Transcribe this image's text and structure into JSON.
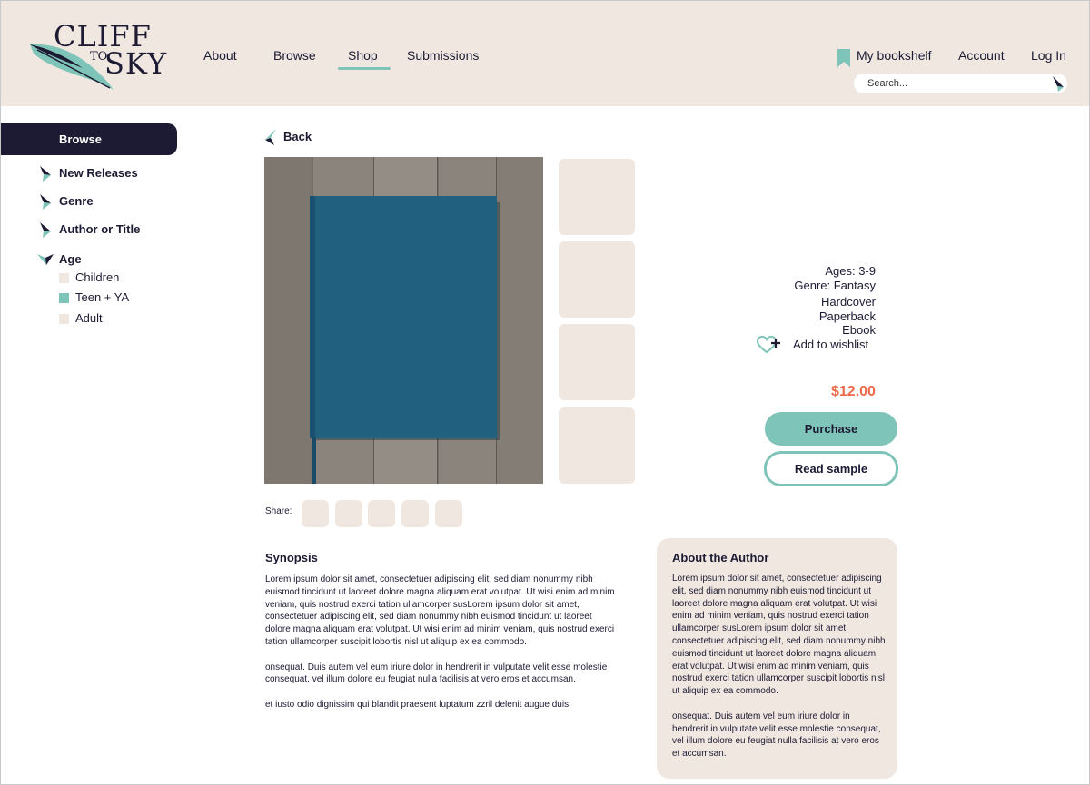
{
  "logo": {
    "line1": "CLIFF",
    "line2": "TO",
    "line3": "SKY"
  },
  "nav": {
    "about": "About",
    "browse": "Browse",
    "shop": "Shop",
    "submissions": "Submissions"
  },
  "header": {
    "bookshelf": "My bookshelf",
    "account": "Account",
    "login": "Log In",
    "search_placeholder": "Search..."
  },
  "sidebar": {
    "heading": "Browse",
    "items": [
      "New Releases",
      "Genre",
      "Author or Title",
      "Age"
    ],
    "age_options": [
      {
        "label": "Children",
        "checked": false
      },
      {
        "label": "Teen + YA",
        "checked": true
      },
      {
        "label": "Adult",
        "checked": false
      }
    ]
  },
  "product": {
    "back": "Back",
    "ages": "Ages: 3-9",
    "genre": "Genre: Fantasy",
    "formats": [
      "Hardcover",
      "Paperback",
      "Ebook"
    ],
    "wishlist": "Add to wishlist",
    "price": "$12.00",
    "purchase": "Purchase",
    "read_sample": "Read sample",
    "share_label": "Share:"
  },
  "synopsis": {
    "title": "Synopsis",
    "paragraphs": [
      "Lorem ipsum dolor sit amet, consectetuer adipiscing elit, sed diam nonummy nibh euismod tincidunt ut laoreet dolore magna aliquam erat volutpat. Ut wisi enim ad minim veniam, quis nostrud exerci tation ullamcorper susLorem ipsum dolor sit amet, consectetuer adipiscing elit, sed diam nonummy nibh euismod tincidunt ut laoreet dolore magna aliquam erat volutpat. Ut wisi enim ad minim veniam, quis nostrud exerci tation ullamcorper suscipit lobortis nisl ut aliquip ex ea commodo.",
      "onsequat. Duis autem vel eum iriure dolor in hendrerit in vulputate velit esse molestie consequat, vel illum dolore eu feugiat nulla facilisis at vero eros et accumsan.",
      "et iusto odio dignissim qui blandit praesent luptatum zzril delenit augue duis"
    ]
  },
  "author": {
    "title": "About the Author",
    "paragraphs": [
      "Lorem ipsum dolor sit amet, consectetuer adipiscing elit, sed diam nonummy nibh euismod tincidunt ut laoreet dolore magna aliquam erat volutpat. Ut wisi enim ad minim veniam, quis nostrud exerci tation ullamcorper susLorem ipsum dolor sit amet, consectetuer adipiscing elit, sed diam nonummy nibh euismod tincidunt ut laoreet dolore magna aliquam erat volutpat. Ut wisi enim ad minim veniam, quis nostrud exerci tation ullamcorper suscipit lobortis nisl ut aliquip ex ea commodo.",
      "onsequat. Duis autem vel eum iriure dolor in hendrerit in vulputate velit esse molestie consequat, vel illum dolore eu feugiat nulla facilisis at vero eros et accumsan."
    ]
  },
  "colors": {
    "navy": "#1c1b33",
    "teal": "#7fc4b8",
    "sand": "#f0e7e1",
    "price": "#f0684a",
    "book": "#21607f",
    "wood": "#8a847d"
  },
  "icons": {
    "bookshelf": "bookmark-icon",
    "search": "arrow-pointer-icon",
    "wishlist": "heart-plus-icon",
    "back": "chevron-left-icon",
    "logo": "feather-icon"
  }
}
